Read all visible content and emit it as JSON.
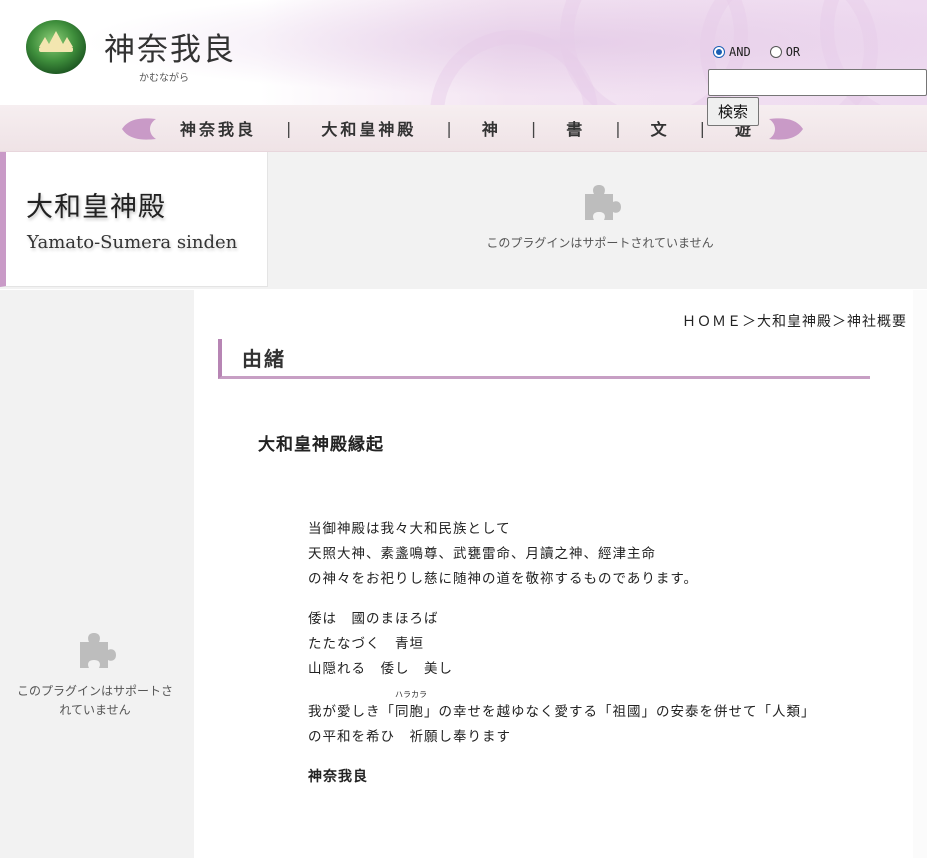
{
  "header": {
    "site_title": "神奈我良",
    "site_reading": "かむながら",
    "search": {
      "and_label": "AND",
      "or_label": "OR",
      "selected": "AND",
      "input_value": "",
      "button_label": "検索"
    }
  },
  "nav": {
    "items": [
      "神奈我良",
      "大和皇神殿",
      "神",
      "書",
      "文",
      "遊"
    ],
    "separator": "|"
  },
  "banner": {
    "title": "大和皇神殿",
    "subtitle": "Yamato-Sumera sinden",
    "plugin_message": "このプラグインはサポートされていません"
  },
  "sidebar": {
    "plugin_message_line1": "このプラグインはサポートさ",
    "plugin_message_line2": "れていません"
  },
  "main": {
    "breadcrumb": "ＨＯＭＥ＞大和皇神殿＞神社概要",
    "section_heading": "由緒",
    "subheading": "大和皇神殿縁起",
    "paragraph1": [
      "当御神殿は我々大和民族として",
      "天照大神、素盞鳴尊、武甕雷命、月讀之神、經津主命",
      "の神々をお祀りし慈に随神の道を敬祢するものであります。"
    ],
    "paragraph2": [
      "倭は　國のまほろば",
      "たたなづく　青垣",
      "山隠れる　倭し　美し"
    ],
    "paragraph3": {
      "line1_before": "我が愛しき「",
      "ruby_base": "同胞",
      "ruby_reading": "ハラカラ",
      "line1_after": "」の幸せを越ゆなく愛する「祖國」の安泰を併せて「人類」",
      "line2": "の平和を希ひ　祈願し奉ります"
    },
    "signature": "神奈我良"
  },
  "colors": {
    "accent_purple": "#b785b4",
    "nav_arrow": "#c99ac7",
    "emblem_green": "#3f8f3c"
  }
}
